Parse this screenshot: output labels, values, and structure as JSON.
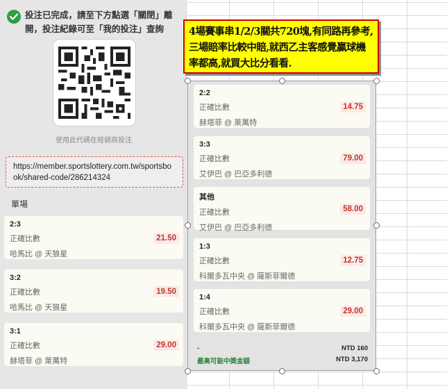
{
  "left": {
    "success_message": "投注已完成，請至下方點選「關閉」離開，投注紀錄可至「我的投注」查詢",
    "qr_caption": "使用此代碼在經銷商投注",
    "share_url": "https://member.sportslottery.com.tw/sportsbook/shared-code/286214324",
    "section_label": "單場",
    "bets": [
      {
        "score": "2:3",
        "market": "正確比數",
        "match": "哈馬比 @ 天狼星",
        "odds": "21.50"
      },
      {
        "score": "3:2",
        "market": "正確比數",
        "match": "哈馬比 @ 天狼星",
        "odds": "19.50"
      },
      {
        "score": "3:1",
        "market": "正確比數",
        "match": "赫塔菲 @ 萊萬特",
        "odds": "29.00"
      }
    ]
  },
  "right": {
    "bets": [
      {
        "score": "2:2",
        "market": "正確比數",
        "match": "赫塔菲 @ 萊萬特",
        "odds": "14.75"
      },
      {
        "score": "3:3",
        "market": "正確比數",
        "match": "艾伊巴 @ 巴亞多利德",
        "odds": "79.00"
      },
      {
        "score": "其他",
        "market": "正確比數",
        "match": "艾伊巴 @ 巴亞多利德",
        "odds": "58.00"
      },
      {
        "score": "1:3",
        "market": "正確比數",
        "match": "科爾多瓦中央 @ 薩斯菲爾德",
        "odds": "12.75"
      },
      {
        "score": "1:4",
        "market": "正確比數",
        "match": "科爾多瓦中央 @ 薩斯菲爾德",
        "odds": "29.00"
      }
    ],
    "summary": {
      "dash": "-",
      "stake": "NTD 160",
      "max_label": "最高可能中獎金額",
      "max_value": "NTD 3,170"
    }
  },
  "annotation": {
    "text": "4場賽事串1/2/3關共720塊,有同路再參考,三場賠率比較中賠,就西乙主客感覺贏球機率都高,就買大比分看看."
  },
  "colors": {
    "accent_green": "#2e9e48",
    "odds_red": "#c0392b",
    "annotation_bg": "#ffff00",
    "annotation_border": "#d00000"
  }
}
